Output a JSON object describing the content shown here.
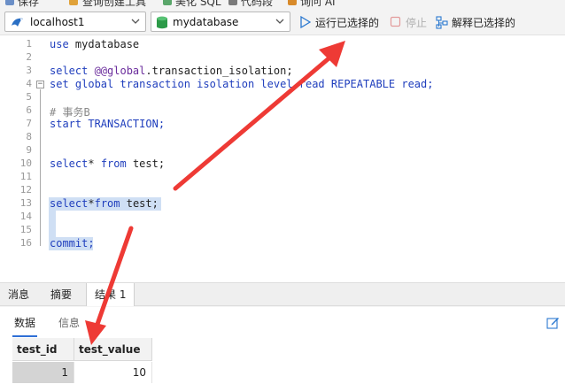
{
  "top_toolbar": {
    "items": [
      "保存",
      "查询创建工具",
      "美化 SQL",
      "代码段",
      "询问 AI"
    ]
  },
  "connection_bar": {
    "connection": "localhost1",
    "database": "mydatabase",
    "run_selected": "运行已选择的",
    "stop": "停止",
    "explain_selected": "解释已选择的"
  },
  "editor": {
    "line_numbers": [
      "1",
      "2",
      "3",
      "4",
      "5",
      "6",
      "7",
      "8",
      "9",
      "10",
      "11",
      "12",
      "13",
      "14",
      "15",
      "16"
    ],
    "lines": {
      "l1": "use mydatabase",
      "l3_a": "select ",
      "l3_b": "@@global",
      "l3_c": ".transaction_isolation;",
      "l4": "set global transaction isolation level read REPEATABLE read;",
      "l6": "# 事务B",
      "l7": "start TRANSACTION;",
      "l10_a": "select",
      "l10_b": "* ",
      "l10_c": "from",
      "l10_d": " test;",
      "l13_a": "select",
      "l13_b": "*",
      "l13_c": "from",
      "l13_d": " test;",
      "l16": "commit;"
    }
  },
  "result_panel": {
    "tabs": [
      "消息",
      "摘要",
      "结果 1"
    ],
    "subtabs": [
      "数据",
      "信息"
    ],
    "columns": [
      "test_id",
      "test_value"
    ],
    "rows": [
      [
        "1",
        "10"
      ]
    ]
  },
  "colors": {
    "keyword": "#1f3ebd",
    "selection": "#cfdff4",
    "arrow": "#ee3a35",
    "accent": "#2f6fd6"
  }
}
